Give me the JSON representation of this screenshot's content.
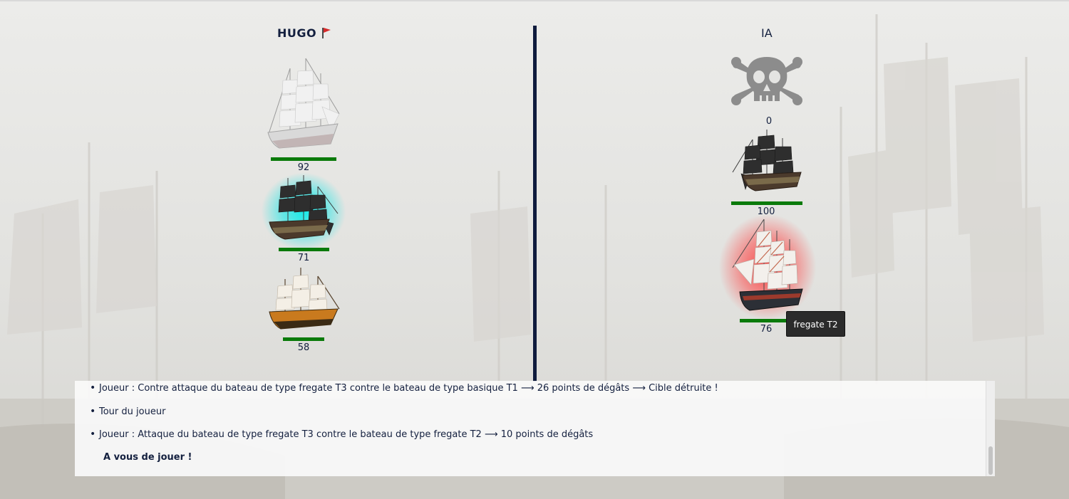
{
  "players": {
    "left": {
      "name": "HUGO",
      "flag_color": "#d62b2b"
    },
    "right": {
      "name": "IA"
    }
  },
  "left_ships": [
    {
      "hp": "92",
      "type": "white clipper",
      "hp_fraction": 0.92
    },
    {
      "hp": "71",
      "type": "pirate galleon",
      "hp_fraction": 0.71,
      "selected": true,
      "glow_color": "#00e6e6"
    },
    {
      "hp": "58",
      "type": "orange frigate",
      "hp_fraction": 0.58
    }
  ],
  "right_ships": [
    {
      "hp": "0",
      "type": "destroyed",
      "icon": "skull-crossbones-icon"
    },
    {
      "hp": "100",
      "type": "pirate galleon",
      "hp_fraction": 1.0
    },
    {
      "hp": "76",
      "type": "red frigate",
      "hp_fraction": 0.76,
      "targeted": true,
      "glow_color": "#ff3030"
    }
  ],
  "tooltip": "fregate T2",
  "log": {
    "entries": [
      "Joueur : Contre attaque du bateau de type fregate T3 contre le bateau de type basique T1 ⟶ 26 points de dégâts ⟶ Cible détruite !",
      "Tour du joueur",
      "Joueur : Attaque du bateau de type fregate T3 contre le bateau de type fregate T2 ⟶ 10 points de dégâts"
    ],
    "prompt": "A vous de jouer !"
  },
  "colors": {
    "hp_bar": "#0a7a0a",
    "divider": "#0f1b3d",
    "text": "#14203f"
  }
}
